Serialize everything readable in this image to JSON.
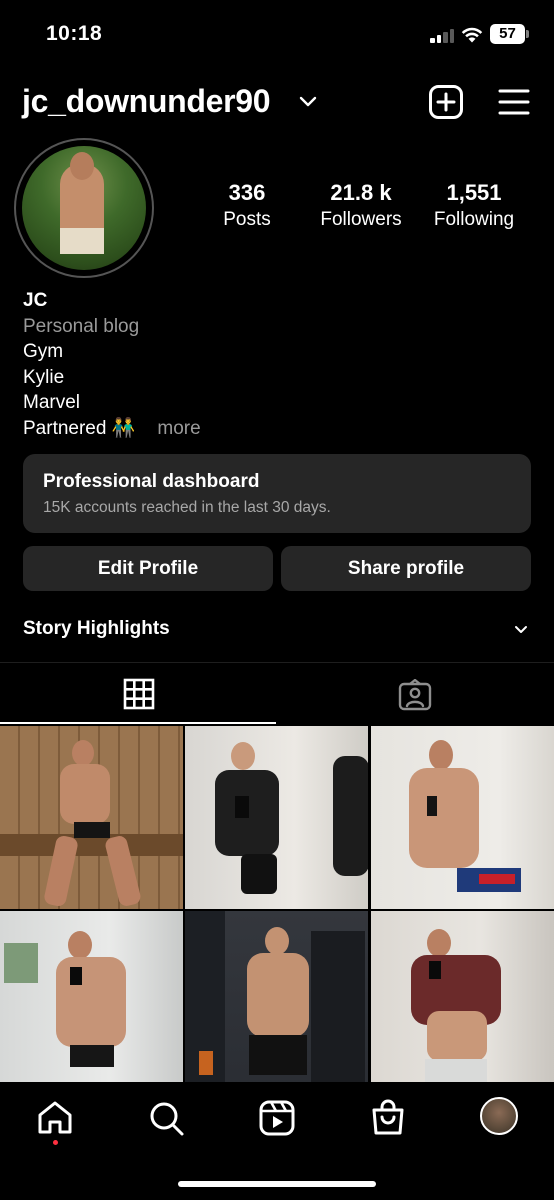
{
  "status_bar": {
    "time": "10:18",
    "battery": "57"
  },
  "header": {
    "username": "jc_downunder90"
  },
  "stats": [
    {
      "value": "336",
      "label": "Posts"
    },
    {
      "value": "21.8 k",
      "label": "Followers"
    },
    {
      "value": "1,551",
      "label": "Following"
    }
  ],
  "bio": {
    "name": "JC",
    "category": "Personal blog",
    "lines": [
      "Gym",
      "Kylie",
      "Marvel"
    ],
    "last_line": "Partnered 👬",
    "more": "more"
  },
  "dashboard": {
    "title": "Professional dashboard",
    "subtitle": "15K accounts reached in the last 30 days."
  },
  "buttons": {
    "edit": "Edit Profile",
    "share": "Share profile"
  },
  "highlights": {
    "title": "Story Highlights"
  },
  "tabs": {
    "active": "grid"
  },
  "posts": [
    {
      "bg": "#8a6a45",
      "fg": "#c9a080",
      "accent": "#1a1a1a"
    },
    {
      "bg": "#d9d6d0",
      "fg": "#d5aa8c",
      "accent": "#1c1c1c"
    },
    {
      "bg": "#e3e1dc",
      "fg": "#c99678",
      "accent": "#1f3a7a"
    },
    {
      "bg": "#d2d4d3",
      "fg": "#c69477",
      "accent": "#161616"
    },
    {
      "bg": "#2a2d33",
      "fg": "#c39272",
      "accent": "#111111"
    },
    {
      "bg": "#e0dcd6",
      "fg": "#c99879",
      "accent": "#6b2a2a"
    }
  ],
  "colors": {
    "background": "#000000",
    "card": "#262626",
    "muted": "#9a9a9a",
    "notification": "#ff3040"
  }
}
